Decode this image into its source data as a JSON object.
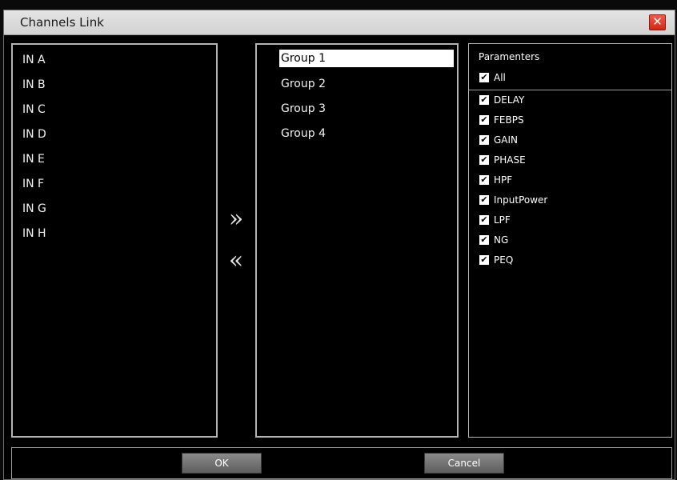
{
  "window": {
    "title": "Channels Link",
    "close_symbol": "✕"
  },
  "channels": [
    "IN A",
    "IN B",
    "IN C",
    "IN D",
    "IN E",
    "IN F",
    "IN G",
    "IN H"
  ],
  "groups": {
    "items": [
      "Group 1",
      "Group 2",
      "Group 3",
      "Group 4"
    ],
    "selected": "Group 1"
  },
  "transfer": {
    "add_symbol": "»",
    "remove_symbol": "«"
  },
  "parameters": {
    "header": "Paramenters",
    "all": {
      "label": "All",
      "checked": true
    },
    "items": [
      {
        "label": "DELAY",
        "checked": true
      },
      {
        "label": "FEBPS",
        "checked": true
      },
      {
        "label": "GAIN",
        "checked": true
      },
      {
        "label": "PHASE",
        "checked": true
      },
      {
        "label": "HPF",
        "checked": true
      },
      {
        "label": "InputPower",
        "checked": true
      },
      {
        "label": "LPF",
        "checked": true
      },
      {
        "label": "NG",
        "checked": true
      },
      {
        "label": "PEQ",
        "checked": true
      }
    ],
    "check_symbol": "✔"
  },
  "buttons": {
    "ok": "OK",
    "cancel": "Cancel"
  },
  "colors": {
    "close": "#e03a2a",
    "selection": "#ffffff",
    "panel_border": "#b4b4b4"
  }
}
